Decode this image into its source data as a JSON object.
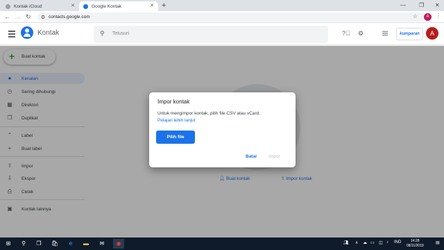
{
  "browser": {
    "tabs": [
      {
        "label": "Kontak iCloud",
        "icon": "apple-icon",
        "active": false
      },
      {
        "label": "Google Kontak",
        "icon": "contacts-favicon",
        "active": true
      }
    ],
    "url": "contacts.google.com",
    "profile_initial": "A"
  },
  "header": {
    "app_name": "Kontak",
    "search_placeholder": "Telusuri",
    "org_label": "kumparan",
    "avatar_initial": "A"
  },
  "sidebar": {
    "create_label": "Buat kontak",
    "items": [
      {
        "label": "Kenalan",
        "icon": "person-icon",
        "active": true
      },
      {
        "label": "Sering dihubungi",
        "icon": "history-icon",
        "active": false
      },
      {
        "label": "Direktori",
        "icon": "directory-icon",
        "active": false
      },
      {
        "label": "Duplikat",
        "icon": "duplicate-icon",
        "active": false
      },
      {
        "label": "Label",
        "icon": "chevron-up-icon",
        "active": false
      },
      {
        "label": "Buat label",
        "icon": "plus-icon",
        "active": false
      },
      {
        "label": "Impor",
        "icon": "upload-icon",
        "active": false
      },
      {
        "label": "Ekspor",
        "icon": "download-icon",
        "active": false
      },
      {
        "label": "Cetak",
        "icon": "print-icon",
        "active": false
      },
      {
        "label": "Kontak lainnya",
        "icon": "other-contacts-icon",
        "active": false
      }
    ]
  },
  "main": {
    "empty_actions": {
      "create": "Buat kontak",
      "import": "Impor kontak"
    }
  },
  "dialog": {
    "title": "Impor kontak",
    "body": "Untuk mengimpor kontak, pilih file CSV atau vCard.",
    "link": "Pelajari lebih lanjut",
    "pick_button": "Pilih file",
    "cancel_button": "Batal",
    "import_button": "Impor"
  },
  "taskbar": {
    "language": "IND",
    "time": "14:28",
    "date": "08/11/2019"
  },
  "colors": {
    "accent": "#1a73e8",
    "avatar": "#b71c1c",
    "taskbar": "#0f1b2b"
  }
}
